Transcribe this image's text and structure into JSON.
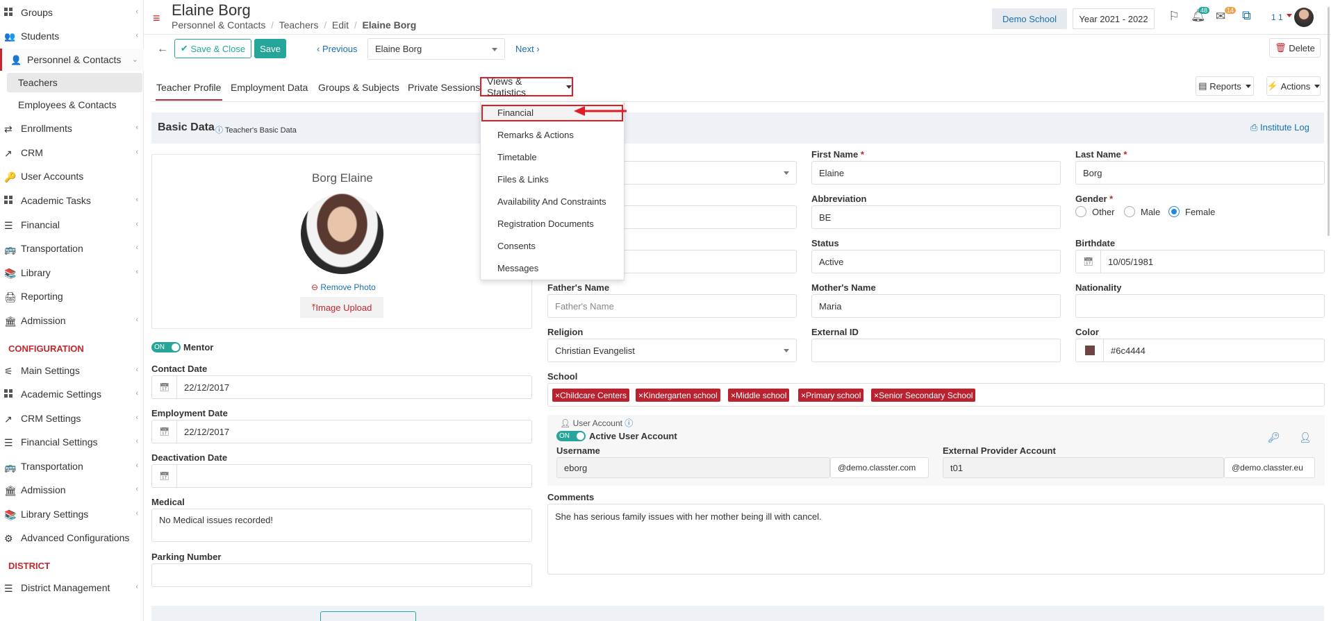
{
  "sidebar": {
    "items": [
      {
        "label": "Groups",
        "icon": "groups-icon"
      },
      {
        "label": "Students",
        "icon": "students-icon"
      },
      {
        "label": "Personnel & Contacts",
        "icon": "personnel-icon"
      },
      {
        "label": "Teachers"
      },
      {
        "label": "Employees & Contacts"
      },
      {
        "label": "Enrollments",
        "icon": "enrollments-icon"
      },
      {
        "label": "CRM",
        "icon": "crm-icon"
      },
      {
        "label": "User Accounts",
        "icon": "key-icon"
      },
      {
        "label": "Academic Tasks",
        "icon": "tasks-icon"
      },
      {
        "label": "Financial",
        "icon": "financial-icon"
      },
      {
        "label": "Transportation",
        "icon": "bus-icon"
      },
      {
        "label": "Library",
        "icon": "library-icon"
      },
      {
        "label": "Reporting",
        "icon": "printer-icon"
      },
      {
        "label": "Admission",
        "icon": "bank-icon"
      }
    ],
    "config_title": "CONFIGURATION",
    "config_items": [
      {
        "label": "Main Settings"
      },
      {
        "label": "Academic Settings"
      },
      {
        "label": "CRM Settings"
      },
      {
        "label": "Financial Settings"
      },
      {
        "label": "Transportation"
      },
      {
        "label": "Admission"
      },
      {
        "label": "Library Settings"
      },
      {
        "label": "Advanced Configurations"
      }
    ],
    "district_title": "DISTRICT",
    "district_items": [
      {
        "label": "District Management"
      }
    ]
  },
  "header": {
    "title": "Elaine Borg",
    "breadcrumb": [
      "Personnel & Contacts",
      "Teachers",
      "Edit",
      "Elaine Borg"
    ],
    "school": "Demo School",
    "year": "Year 2021 - 2022",
    "notif_count": "48",
    "mail_count": "14",
    "user_short": "1 1"
  },
  "toolbar": {
    "save_close": "Save & Close",
    "save": "Save",
    "previous": "Previous",
    "record": "Elaine Borg",
    "next": "Next",
    "delete": "Delete",
    "reports": "Reports",
    "actions": "Actions"
  },
  "tabs": [
    "Teacher Profile",
    "Employment Data",
    "Groups & Subjects",
    "Private Sessions",
    "Views & Statistics"
  ],
  "menu": [
    "Financial",
    "Remarks & Actions",
    "Timetable",
    "Files & Links",
    "Availability And Constraints",
    "Registration Documents",
    "Consents",
    "Messages"
  ],
  "basic": {
    "title": "Basic Data",
    "subtitle": "Teacher's Basic Data",
    "institute_log": "Institute Log",
    "name": "Borg Elaine",
    "remove_photo": "Remove Photo",
    "image_upload": "Image Upload",
    "mentor_on": "ON",
    "mentor": "Mentor",
    "contact_date_label": "Contact Date",
    "contact_date": "22/12/2017",
    "employment_date_label": "Employment Date",
    "employment_date": "22/12/2017",
    "deactivation_label": "Deactivation Date",
    "medical_label": "Medical",
    "medical": "No Medical issues recorded!",
    "parking_label": "Parking Number"
  },
  "form": {
    "first_name_label": "First Name",
    "first_name": "Elaine",
    "last_name_label": "Last Name",
    "last_name": "Borg",
    "abbr_label": "Abbreviation",
    "abbr": "BE",
    "gender_label": "Gender",
    "gender_options": [
      "Other",
      "Male",
      "Female"
    ],
    "status_label": "Status",
    "status": "Active",
    "birthdate_label": "Birthdate",
    "birthdate": "10/05/1981",
    "father_label": "Father's Name",
    "father_placeholder": "Father's Name",
    "mother_label": "Mother's Name",
    "mother": "Maria",
    "nationality_label": "Nationality",
    "religion_label": "Religion",
    "religion": "Christian Evangelist",
    "external_id_label": "External ID",
    "color_label": "Color",
    "color": "#6c4444",
    "school_label": "School",
    "schools": [
      "Childcare Centers",
      "Kindergarten school",
      "Middle school",
      "Primary school",
      "Senior Secondary School"
    ],
    "user_account_title": "User Account",
    "active_on": "ON",
    "active_label": "Active User Account",
    "username_label": "Username",
    "username": "eborg",
    "username_domain": "@demo.classter.com",
    "ext_provider_label": "External Provider Account",
    "ext_provider": "t01",
    "ext_domain": "@demo.classter.eu",
    "comments_label": "Comments",
    "comments": "She has serious family issues with her mother being ill with cancel."
  },
  "colors": {
    "accent": "#26a69a",
    "red": "#c0282d",
    "highlight": "#e01b24"
  }
}
